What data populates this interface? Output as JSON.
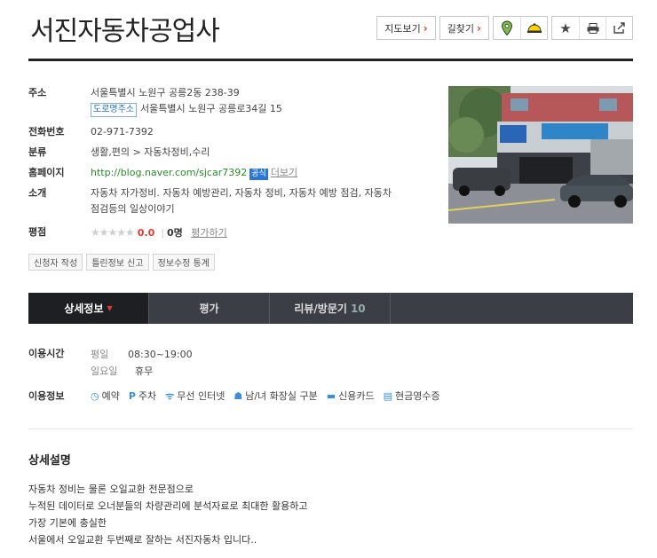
{
  "title": "서진자동차공업사",
  "actions": {
    "map_view": "지도보기",
    "directions": "길찾기"
  },
  "info": {
    "address_label": "주소",
    "address": "서울특별시 노원구 공릉2동 238-39",
    "road_tag": "도로명주소",
    "road_address": "서울특별시 노원구 공릉로34길 15",
    "phone_label": "전화번호",
    "phone": "02-971-7392",
    "category_label": "분류",
    "category": "생활,편의 > 자동차정비,수리",
    "homepage_label": "홈페이지",
    "homepage": "http://blog.naver.com/sjcar7392",
    "official_badge": "공식",
    "more_link": "더보기",
    "intro_label": "소개",
    "intro_line1": "자동차 자가정비. 자동차 예방관리, 자동차 정비, 자동차 예방 점검, 자동차",
    "intro_line2": "점검등의 일상이야기",
    "rating_label": "평점",
    "stars": "★★★★★",
    "score": "0.0",
    "rating_count": "0명",
    "rate_link": "평가하기"
  },
  "small_buttons": [
    "신청자 작성",
    "틀린정보 신고",
    "정보수정 통계"
  ],
  "tabs": [
    {
      "label": "상세정보",
      "active": true
    },
    {
      "label": "평가",
      "active": false
    },
    {
      "label": "리뷰/방문기",
      "count": "10",
      "active": false
    }
  ],
  "usage": {
    "hours_label": "이용시간",
    "weekday": "평일",
    "weekday_hours": "08:30~19:00",
    "sunday": "일요일",
    "sunday_hours": "휴무",
    "facilities_label": "이용정보",
    "facilities": [
      "예약",
      "주차",
      "무선 인터넷",
      "남/녀 화장실 구분",
      "신용카드",
      "현금영수증"
    ]
  },
  "description": {
    "title": "상세설명",
    "lines": [
      "자동차 정비는 물론 오일교환 전문점으로",
      "누적된 데이터로 오너분들의 차량관리에 분석자료로 최대한 활용하고",
      "가장 기본에 충실한",
      "서울에서 오일교환 두번째로 잘하는 서진자동차 입니다.."
    ]
  },
  "colors": {
    "accent_red": "#e03a2f",
    "tab_bar": "#3b3e45",
    "tab_active": "#1e1f23",
    "link_blue": "#2a76d8",
    "link_green": "#2a8a2a"
  }
}
